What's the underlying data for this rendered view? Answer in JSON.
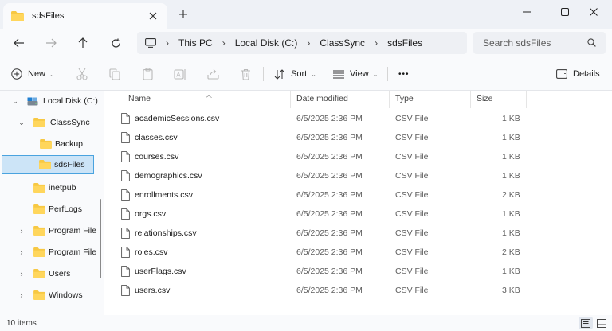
{
  "window": {
    "tab_title": "sdsFiles",
    "colors": {
      "folder": "#f7c843",
      "selection": "#cce4f7",
      "selection_border": "#4aa3df"
    }
  },
  "address": {
    "crumbs": [
      "This PC",
      "Local Disk (C:)",
      "ClassSync",
      "sdsFiles"
    ],
    "search_placeholder": "Search sdsFiles"
  },
  "toolbar": {
    "new_label": "New",
    "sort_label": "Sort",
    "view_label": "View",
    "more_label": "•••",
    "details_label": "Details"
  },
  "sidebar": {
    "items": [
      {
        "label": "Local Disk (C:)",
        "icon": "drive-icon",
        "caret": "expanded"
      },
      {
        "label": "ClassSync",
        "icon": "folder-icon",
        "caret": "expanded"
      },
      {
        "label": "Backup",
        "icon": "folder-icon",
        "caret": "none"
      },
      {
        "label": "sdsFiles",
        "icon": "folder-icon",
        "caret": "none",
        "selected": true
      },
      {
        "label": "inetpub",
        "icon": "folder-icon",
        "caret": "none"
      },
      {
        "label": "PerfLogs",
        "icon": "folder-icon",
        "caret": "none"
      },
      {
        "label": "Program File",
        "icon": "folder-icon",
        "caret": "collapsed"
      },
      {
        "label": "Program File",
        "icon": "folder-icon",
        "caret": "collapsed"
      },
      {
        "label": "Users",
        "icon": "folder-icon",
        "caret": "collapsed"
      },
      {
        "label": "Windows",
        "icon": "folder-icon",
        "caret": "collapsed"
      }
    ]
  },
  "table": {
    "columns": {
      "name": "Name",
      "date": "Date modified",
      "type": "Type",
      "size": "Size"
    },
    "rows": [
      {
        "name": "academicSessions.csv",
        "date": "6/5/2025 2:36 PM",
        "type": "CSV File",
        "size": "1 KB"
      },
      {
        "name": "classes.csv",
        "date": "6/5/2025 2:36 PM",
        "type": "CSV File",
        "size": "1 KB"
      },
      {
        "name": "courses.csv",
        "date": "6/5/2025 2:36 PM",
        "type": "CSV File",
        "size": "1 KB"
      },
      {
        "name": "demographics.csv",
        "date": "6/5/2025 2:36 PM",
        "type": "CSV File",
        "size": "1 KB"
      },
      {
        "name": "enrollments.csv",
        "date": "6/5/2025 2:36 PM",
        "type": "CSV File",
        "size": "2 KB"
      },
      {
        "name": "orgs.csv",
        "date": "6/5/2025 2:36 PM",
        "type": "CSV File",
        "size": "1 KB"
      },
      {
        "name": "relationships.csv",
        "date": "6/5/2025 2:36 PM",
        "type": "CSV File",
        "size": "1 KB"
      },
      {
        "name": "roles.csv",
        "date": "6/5/2025 2:36 PM",
        "type": "CSV File",
        "size": "2 KB"
      },
      {
        "name": "userFlags.csv",
        "date": "6/5/2025 2:36 PM",
        "type": "CSV File",
        "size": "1 KB"
      },
      {
        "name": "users.csv",
        "date": "6/5/2025 2:36 PM",
        "type": "CSV File",
        "size": "3 KB"
      }
    ]
  },
  "status": {
    "item_count": "10 items"
  }
}
